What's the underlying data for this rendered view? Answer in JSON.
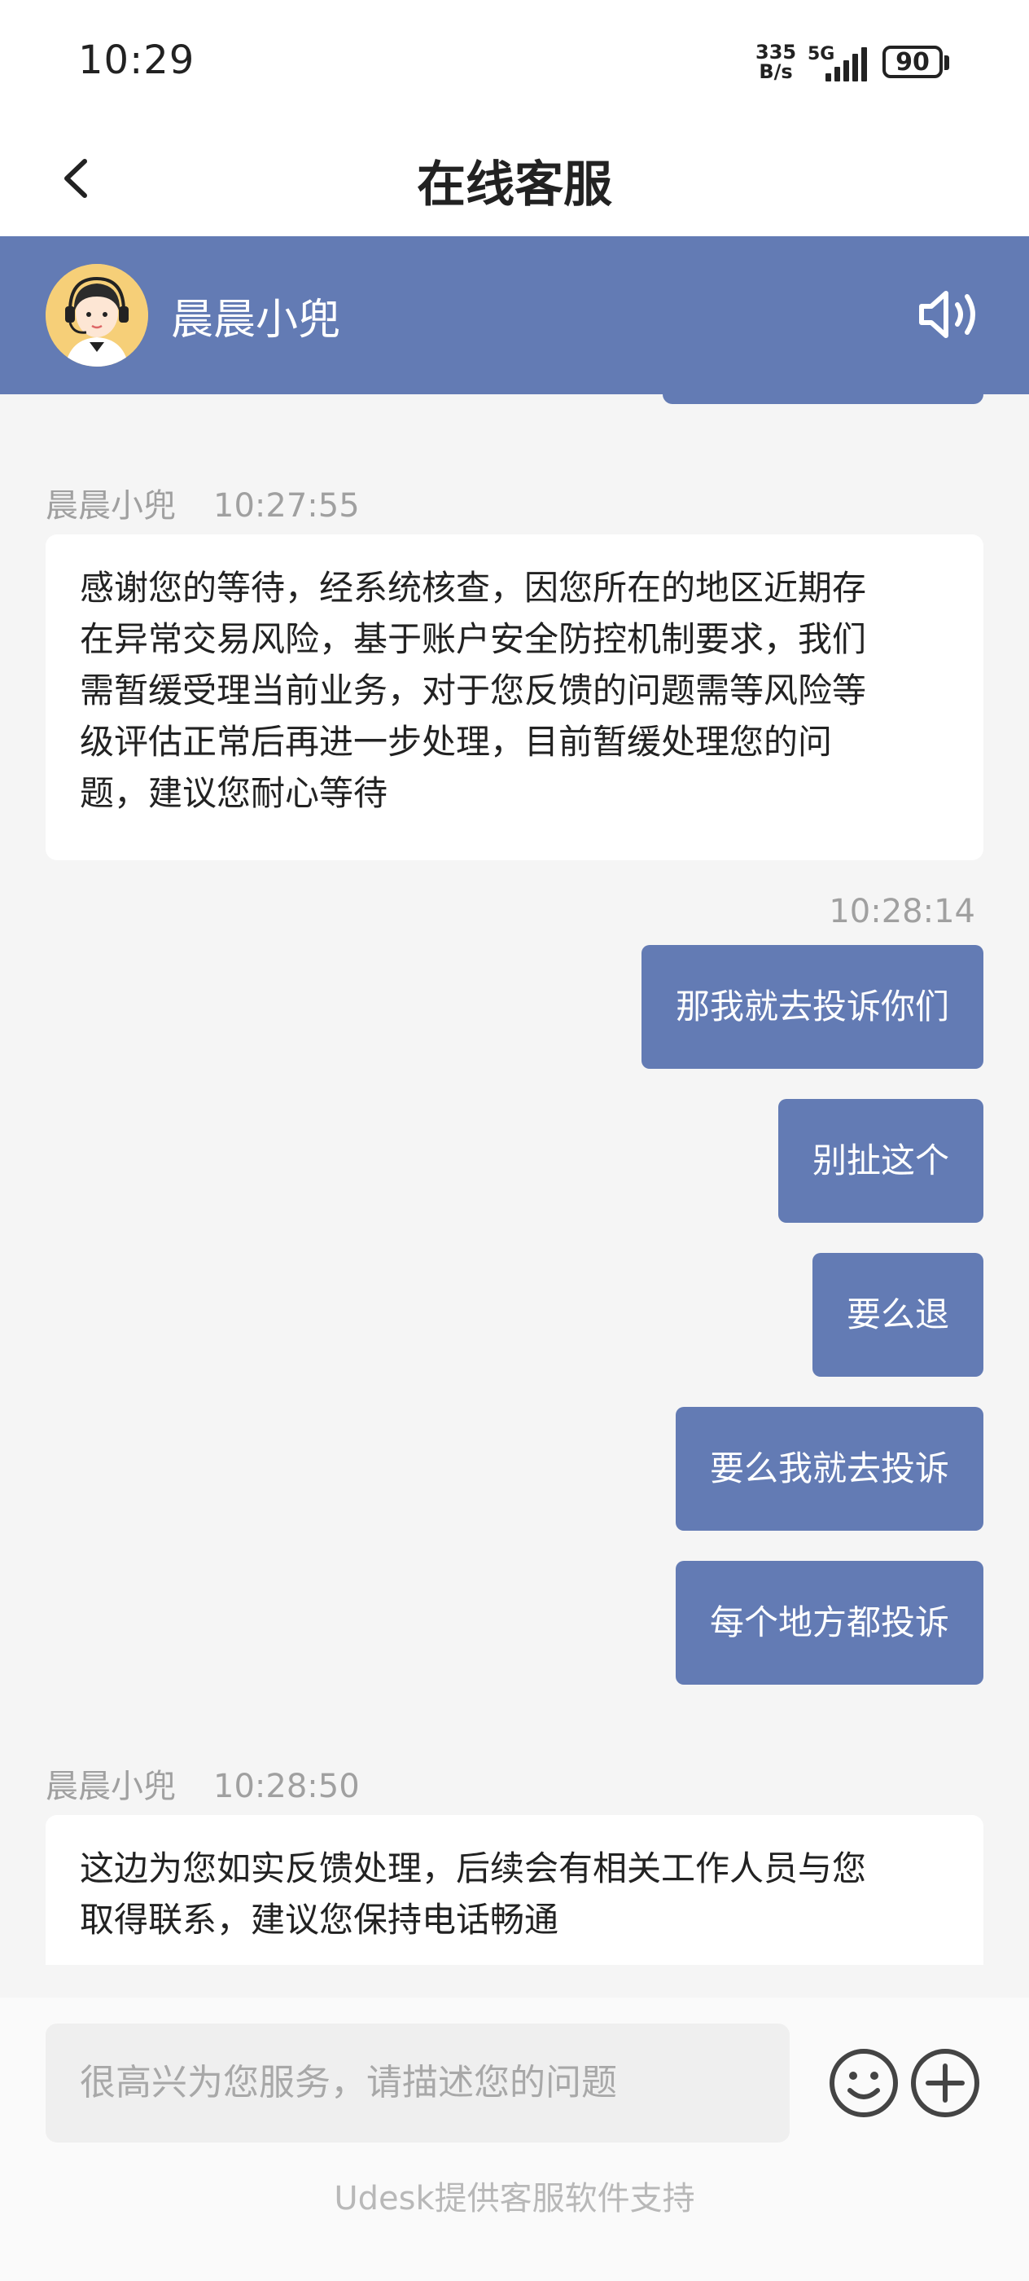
{
  "status_bar": {
    "time": "10:29",
    "net_speed_value": "335",
    "net_speed_unit": "B/s",
    "network": "5G",
    "battery": "90"
  },
  "nav": {
    "title": "在线客服",
    "back_icon": "chevron-left-icon"
  },
  "agent": {
    "name": "晨晨小兜",
    "avatar_icon": "agent-headset-avatar",
    "speaker_icon": "speaker-icon"
  },
  "messages": [
    {
      "direction": "in",
      "sender": "晨晨小兜",
      "time": "10:27:55",
      "lines": [
        "感谢您的等待，经系统核查，因您所在的地区近期存",
        "在异常交易风险，基于账户安全防控机制要求，我们",
        "需暂缓受理当前业务，对于您反馈的问题需等风险等",
        "级评估正常后再进一步处理，目前暂缓处理您的问",
        "题，建议您耐心等待"
      ]
    },
    {
      "direction": "out",
      "time": "10:28:14",
      "texts": [
        "那我就去投诉你们",
        "别扯这个",
        "要么退",
        "要么我就去投诉",
        "每个地方都投诉"
      ]
    },
    {
      "direction": "in",
      "sender": "晨晨小兜",
      "time": "10:28:50",
      "lines": [
        "这边为您如实反馈处理，后续会有相关工作人员与您",
        "取得联系，建议您保持电话畅通"
      ]
    }
  ],
  "input": {
    "placeholder": "很高兴为您服务，请描述您的问题",
    "emoji_icon": "emoji-icon",
    "plus_icon": "plus-icon"
  },
  "footer": {
    "powered_by": "Udesk提供客服软件支持"
  },
  "colors": {
    "accent": "#637bb4",
    "background": "#f5f5f5",
    "bubble_in": "#ffffff",
    "meta_text": "#a0a0a0"
  }
}
